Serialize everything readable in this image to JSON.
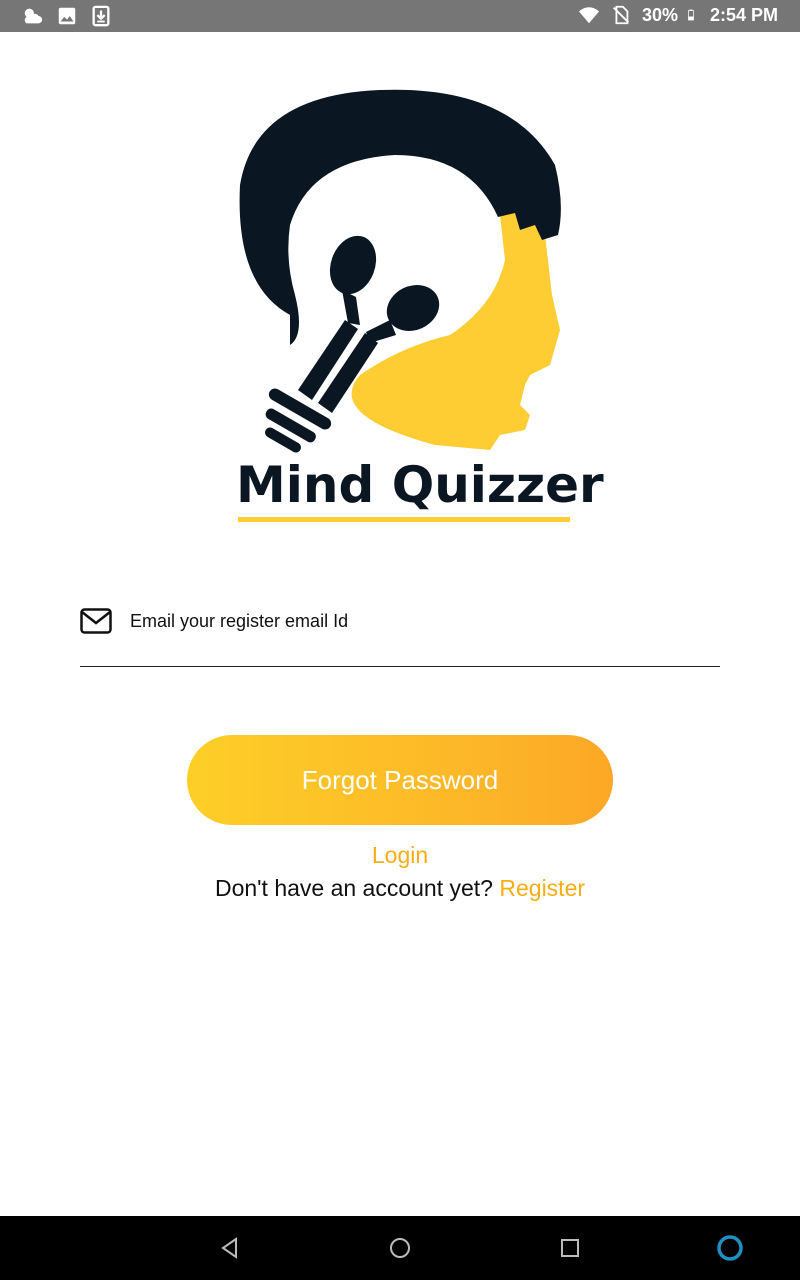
{
  "status_bar": {
    "battery_text": "30%",
    "time": "2:54 PM",
    "icons": [
      "weather-icon",
      "image-icon",
      "download-icon",
      "wifi-icon",
      "no-sim-icon",
      "battery-icon"
    ]
  },
  "logo": {
    "app_name": "Mind Quizzer",
    "brand_dark": "#0b1623",
    "brand_yellow": "#fdcd33"
  },
  "email_field": {
    "placeholder": "Email your register email Id",
    "value": ""
  },
  "forgot_button": {
    "label": "Forgot Password"
  },
  "login_link": {
    "label": "Login"
  },
  "register": {
    "prompt": "Don't have an account yet?",
    "link": "Register"
  },
  "colors": {
    "accent": "#f9ad14",
    "button_gradient_start": "#fdcf27",
    "button_gradient_end": "#fca826",
    "status_bar": "#767676"
  },
  "nav_bar": {
    "icons": [
      "back-icon",
      "home-icon",
      "recents-icon",
      "assistant-icon"
    ]
  }
}
